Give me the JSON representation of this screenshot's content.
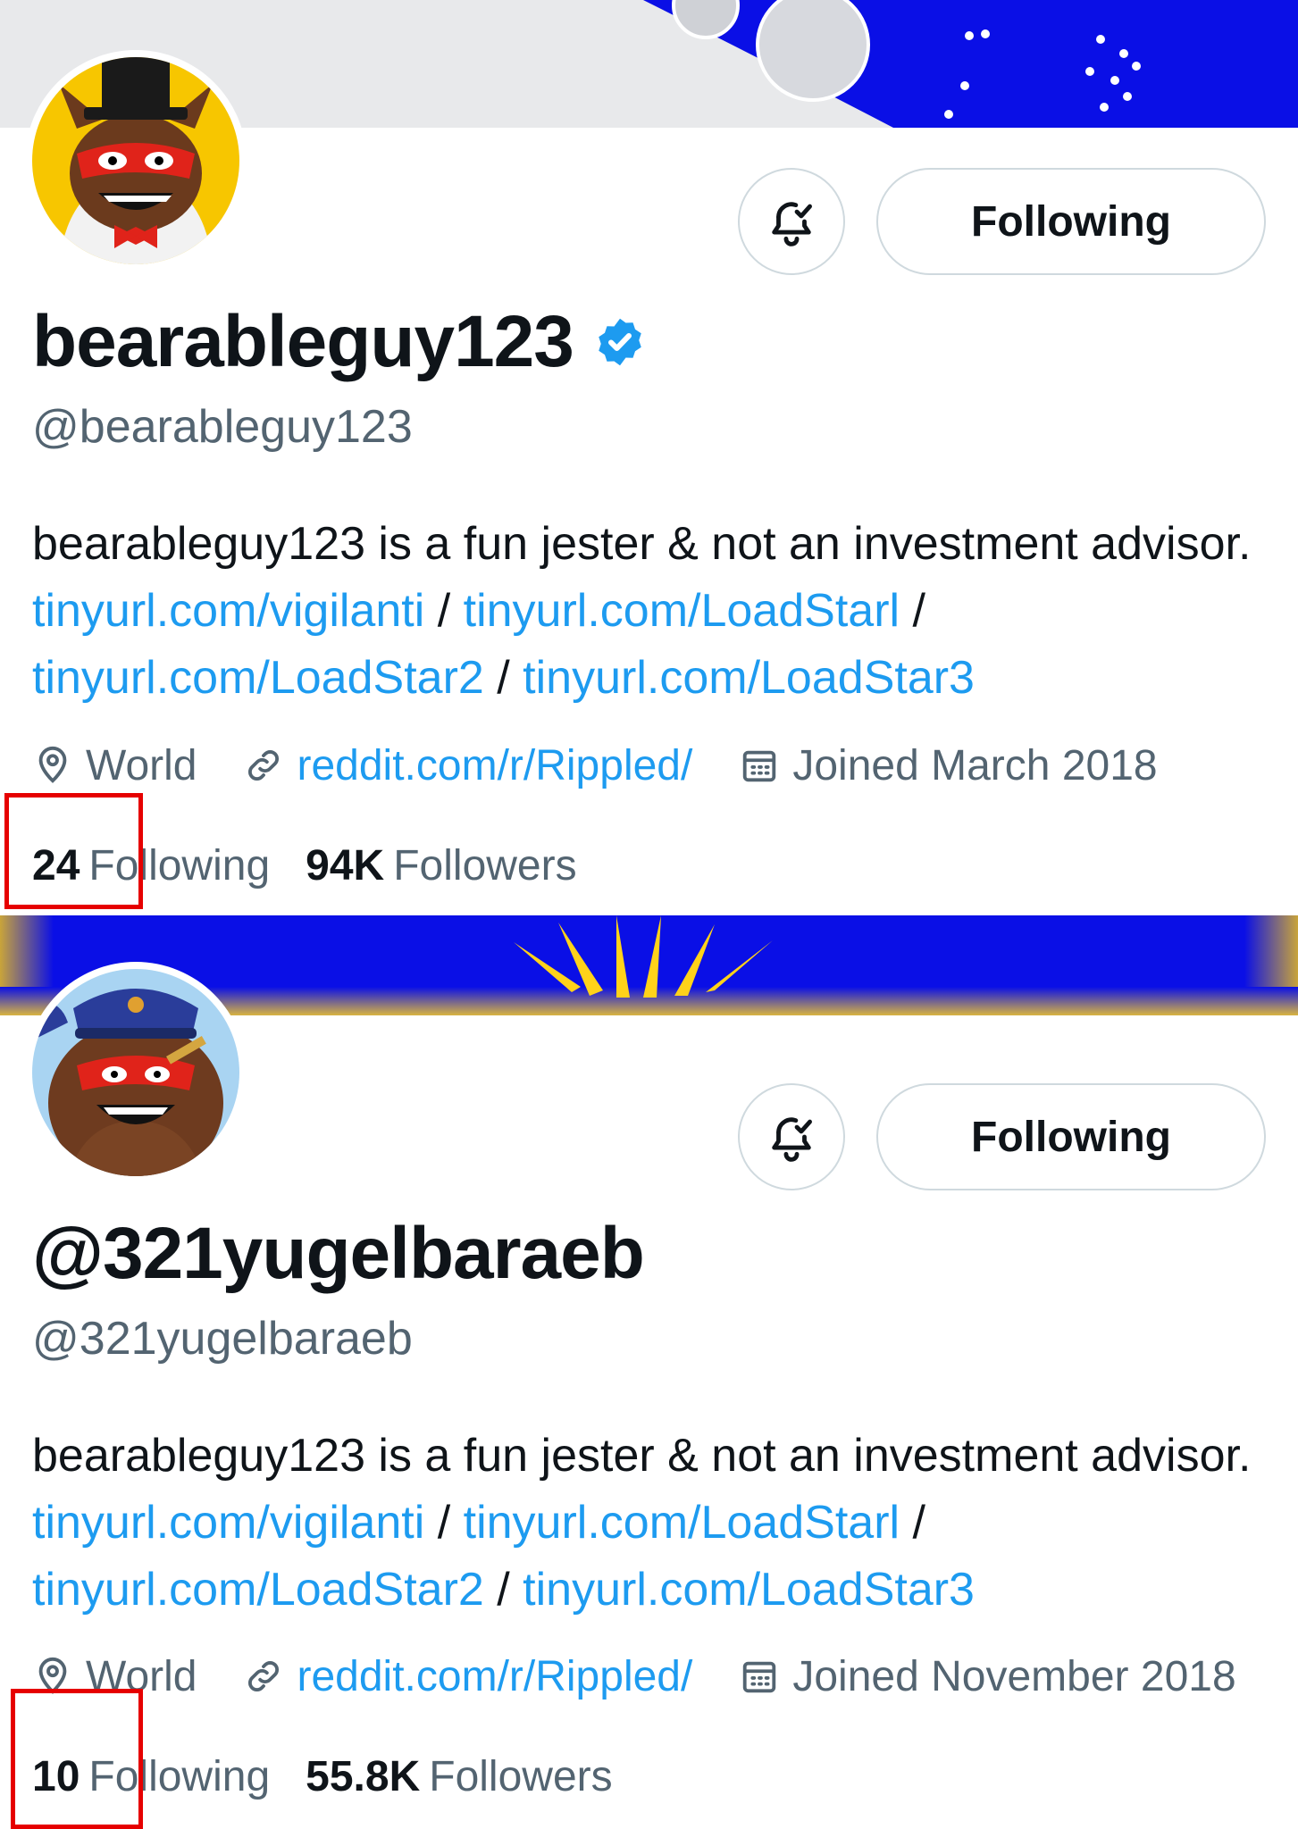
{
  "profiles": [
    {
      "display_name": "bearableguy123",
      "verified": true,
      "handle": "@bearableguy123",
      "follow_button": "Following",
      "bio": {
        "text": "bearableguy123 is a fun jester & not an investment advisor.",
        "links": [
          "tinyurl.com/vigilanti",
          "tinyurl.com/LoadStarl",
          "tinyurl.com/LoadStar2",
          "tinyurl.com/LoadStar3"
        ],
        "separator": "/"
      },
      "location": "World",
      "website": "reddit.com/r/Rippled/",
      "joined": "Joined March 2018",
      "following_count": "24",
      "following_label": "Following",
      "followers_count": "94K",
      "followers_label": "Followers"
    },
    {
      "display_name": "@321yugelbaraeb",
      "verified": false,
      "handle": "@321yugelbaraeb",
      "follow_button": "Following",
      "bio": {
        "text": "bearableguy123 is a fun jester & not an investment advisor.",
        "links": [
          "tinyurl.com/vigilanti",
          "tinyurl.com/LoadStarl",
          "tinyurl.com/LoadStar2",
          "tinyurl.com/LoadStar3"
        ],
        "separator": "/"
      },
      "location": "World",
      "website": "reddit.com/r/Rippled/",
      "joined": "Joined November 2018",
      "following_count": "10",
      "following_label": "Following",
      "followers_count": "55.8K",
      "followers_label": "Followers"
    }
  ],
  "icons": {
    "notification": "bell-check-icon",
    "verified": "verified-badge-icon",
    "location": "location-pin-icon",
    "website": "link-icon",
    "joined": "calendar-icon"
  },
  "colors": {
    "link": "#1d9bf0",
    "secondary_text": "#536471",
    "verified_badge": "#1d9bf0",
    "highlight_box": "#e60000",
    "banner_blue": "#0a0fe6",
    "banner_gold": "#f5b800"
  }
}
